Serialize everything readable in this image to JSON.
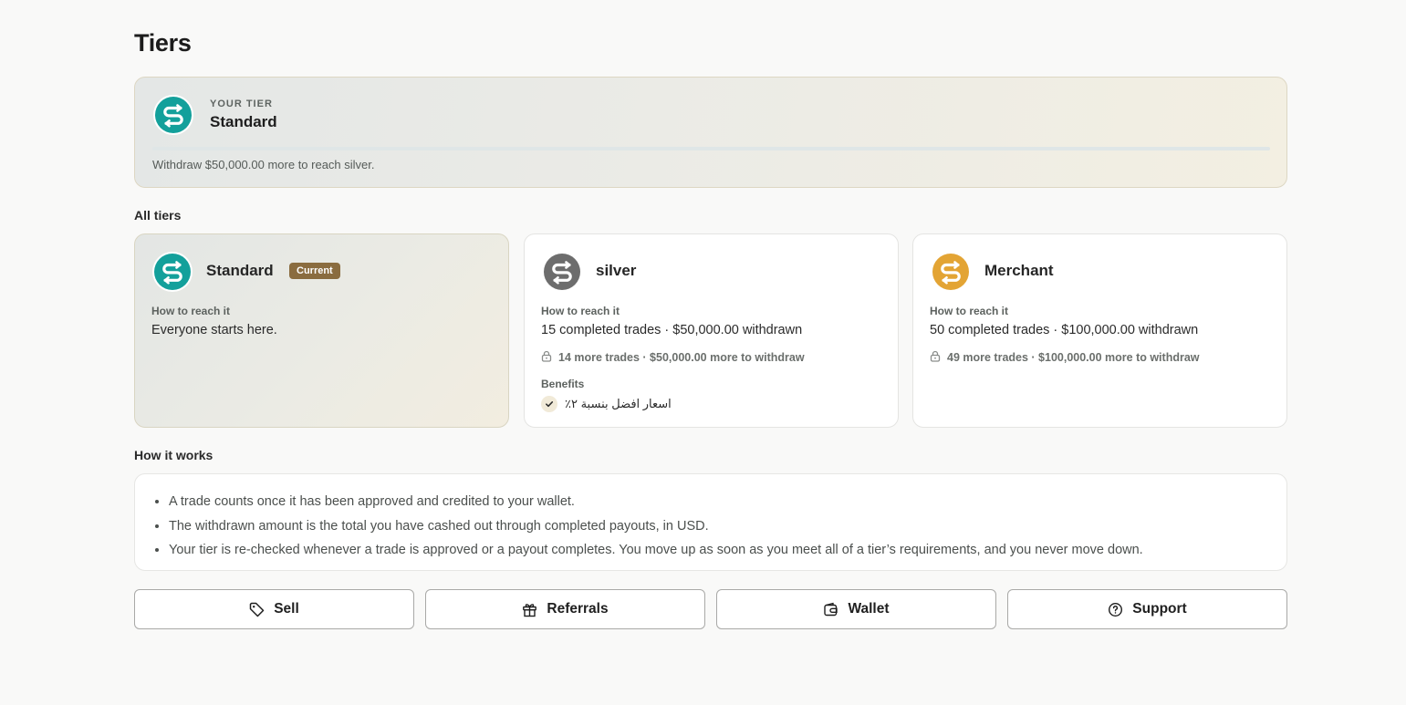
{
  "page": {
    "title": "Tiers"
  },
  "your_tier": {
    "eyebrow": "YOUR TIER",
    "name": "Standard",
    "progress": 0.0,
    "hint": "Withdraw $50,000.00 more to reach silver."
  },
  "all_tiers": {
    "label": "All tiers",
    "cards": [
      {
        "name": "Standard",
        "badge": "Current",
        "logo_color": "#13a09b",
        "logo_icon": "s-arrows-icon",
        "req_label": "How to reach it",
        "req_value": "Everyone starts here."
      },
      {
        "name": "silver",
        "logo_color": "#6d6d6d",
        "logo_icon": "s-arrows-icon",
        "req_label": "How to reach it",
        "req_value": "15 completed trades · $50,000.00 withdrawn",
        "remaining": "14 more trades · $50,000.00 more to withdraw",
        "benefits_label": "Benefits",
        "benefit": "اسعار افضل بنسبة ٢٪"
      },
      {
        "name": "Merchant",
        "logo_color": "#e3a434",
        "logo_icon": "s-arrows-icon",
        "req_label": "How to reach it",
        "req_value": "50 completed trades · $100,000.00 withdrawn",
        "remaining": "49 more trades · $100,000.00 more to withdraw"
      }
    ]
  },
  "how_it_works": {
    "label": "How it works",
    "items": [
      "A trade counts once it has been approved and credited to your wallet.",
      "The withdrawn amount is the total you have cashed out through completed payouts, in USD.",
      "Your tier is re-checked whenever a trade is approved or a payout completes. You move up as soon as you meet all of a tier’s requirements, and you never move down."
    ]
  },
  "actions": [
    {
      "label": "Sell",
      "icon": "tag-icon"
    },
    {
      "label": "Referrals",
      "icon": "gift-icon"
    },
    {
      "label": "Wallet",
      "icon": "wallet-icon"
    },
    {
      "label": "Support",
      "icon": "help-circle-icon"
    }
  ],
  "colors": {
    "accent": "#13a09b",
    "badge": "#8a6c3f",
    "silver": "#6d6d6d",
    "merchant": "#e3a434"
  }
}
